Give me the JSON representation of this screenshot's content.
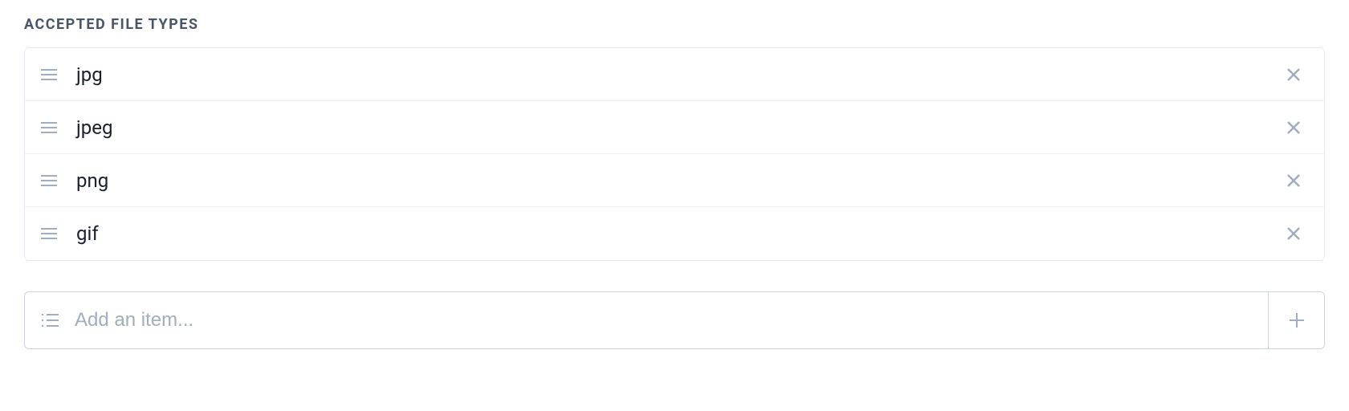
{
  "section_label": "Accepted file types",
  "items": [
    {
      "value": "jpg"
    },
    {
      "value": "jpeg"
    },
    {
      "value": "png"
    },
    {
      "value": "gif"
    }
  ],
  "add_placeholder": "Add an item..."
}
